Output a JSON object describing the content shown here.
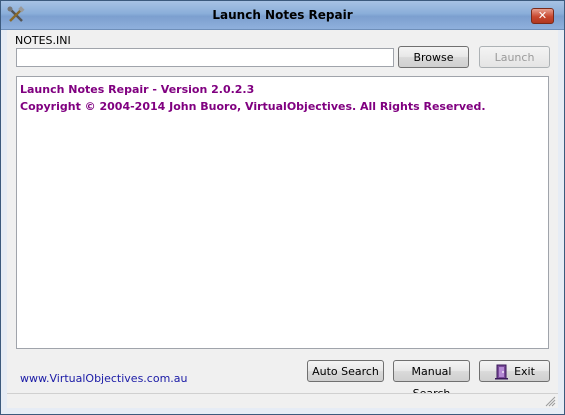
{
  "window": {
    "title": "Launch Notes Repair",
    "close_label": "✕"
  },
  "form": {
    "notes_label": "NOTES.INI",
    "path_value": "",
    "browse_label": "Browse",
    "launch_label": "Launch"
  },
  "output": {
    "lines": [
      "Launch Notes Repair - Version 2.0.2.3",
      "Copyright © 2004-2014 John Buoro, VirtualObjectives. All Rights Reserved."
    ],
    "text_color": "#800080"
  },
  "footer": {
    "site_link": "www.VirtualObjectives.com.au",
    "auto_search_label": "Auto Search",
    "manual_search_label": "Manual Search",
    "exit_label": "Exit"
  },
  "icons": {
    "app": "tools-icon",
    "exit": "exit-door-icon"
  }
}
